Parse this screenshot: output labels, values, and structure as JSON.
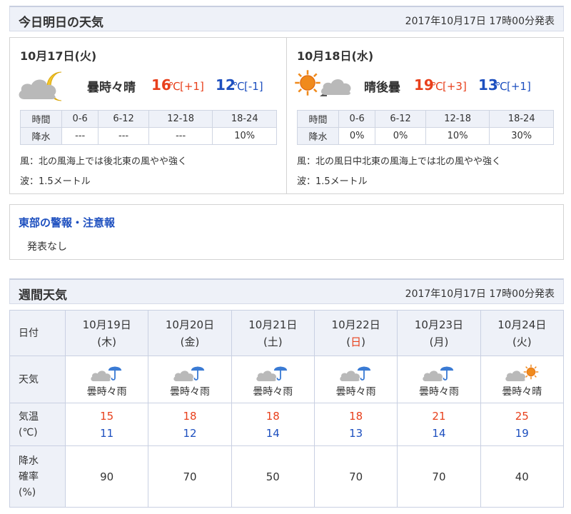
{
  "today_section": {
    "title": "今日明日の天気",
    "issued": "2017年10月17日 17時00分発表"
  },
  "days": [
    {
      "date": "10月17日(火)",
      "weather": "曇時々晴",
      "icon": "cloud-moon-icon",
      "high": "16",
      "high_unit": "℃",
      "high_diff": "[+1]",
      "low": "12",
      "low_unit": "℃",
      "low_diff": "[-1]",
      "precip": {
        "label_time": "時間",
        "label_rain": "降水",
        "periods": [
          "0-6",
          "6-12",
          "12-18",
          "18-24"
        ],
        "values": [
          "---",
          "---",
          "---",
          "10%"
        ]
      },
      "wind": "風：北の風海上では後北東の風やや強く",
      "wave": "波：1.5メートル"
    },
    {
      "date": "10月18日(水)",
      "weather": "晴後曇",
      "icon": "sun-then-cloud-icon",
      "high": "19",
      "high_unit": "℃",
      "high_diff": "[+3]",
      "low": "13",
      "low_unit": "℃",
      "low_diff": "[+1]",
      "precip": {
        "label_time": "時間",
        "label_rain": "降水",
        "periods": [
          "0-6",
          "6-12",
          "12-18",
          "18-24"
        ],
        "values": [
          "0%",
          "0%",
          "10%",
          "30%"
        ]
      },
      "wind": "風：北の風日中北東の風海上では北の風やや強く",
      "wave": "波：1.5メートル"
    }
  ],
  "warnings": {
    "title": "東部の警報・注意報",
    "text": "発表なし"
  },
  "weekly_section": {
    "title": "週間天気",
    "issued": "2017年10月17日 17時00分発表"
  },
  "weekly": {
    "labels": {
      "date": "日付",
      "weather": "天気",
      "temp_line1": "気温",
      "temp_line2": "(℃)",
      "pop_line1": "降水",
      "pop_line2": "確率",
      "pop_line3": "(%)"
    },
    "days": [
      {
        "date": "10月19日",
        "dow": "(木)",
        "weather": "曇時々雨",
        "icon": "cloud-umbrella-icon",
        "high": "15",
        "low": "11",
        "pop": "90"
      },
      {
        "date": "10月20日",
        "dow": "(金)",
        "weather": "曇時々雨",
        "icon": "cloud-umbrella-icon",
        "high": "18",
        "low": "12",
        "pop": "70"
      },
      {
        "date": "10月21日",
        "dow": "(土)",
        "weather": "曇時々雨",
        "icon": "cloud-umbrella-icon",
        "high": "18",
        "low": "14",
        "pop": "50"
      },
      {
        "date": "10月22日",
        "dow_open": "(",
        "dow_char": "日",
        "dow_close": ")",
        "weather": "曇時々雨",
        "icon": "cloud-umbrella-icon",
        "high": "18",
        "low": "13",
        "pop": "70"
      },
      {
        "date": "10月23日",
        "dow": "(月)",
        "weather": "曇時々雨",
        "icon": "cloud-umbrella-icon",
        "high": "21",
        "low": "14",
        "pop": "70"
      },
      {
        "date": "10月24日",
        "dow": "(火)",
        "weather": "曇時々晴",
        "icon": "cloud-sun-icon",
        "high": "25",
        "low": "19",
        "pop": "40"
      }
    ]
  },
  "colors": {
    "high": "#e8401c",
    "low": "#1d4fbf",
    "header_bg": "#eef1f8"
  }
}
